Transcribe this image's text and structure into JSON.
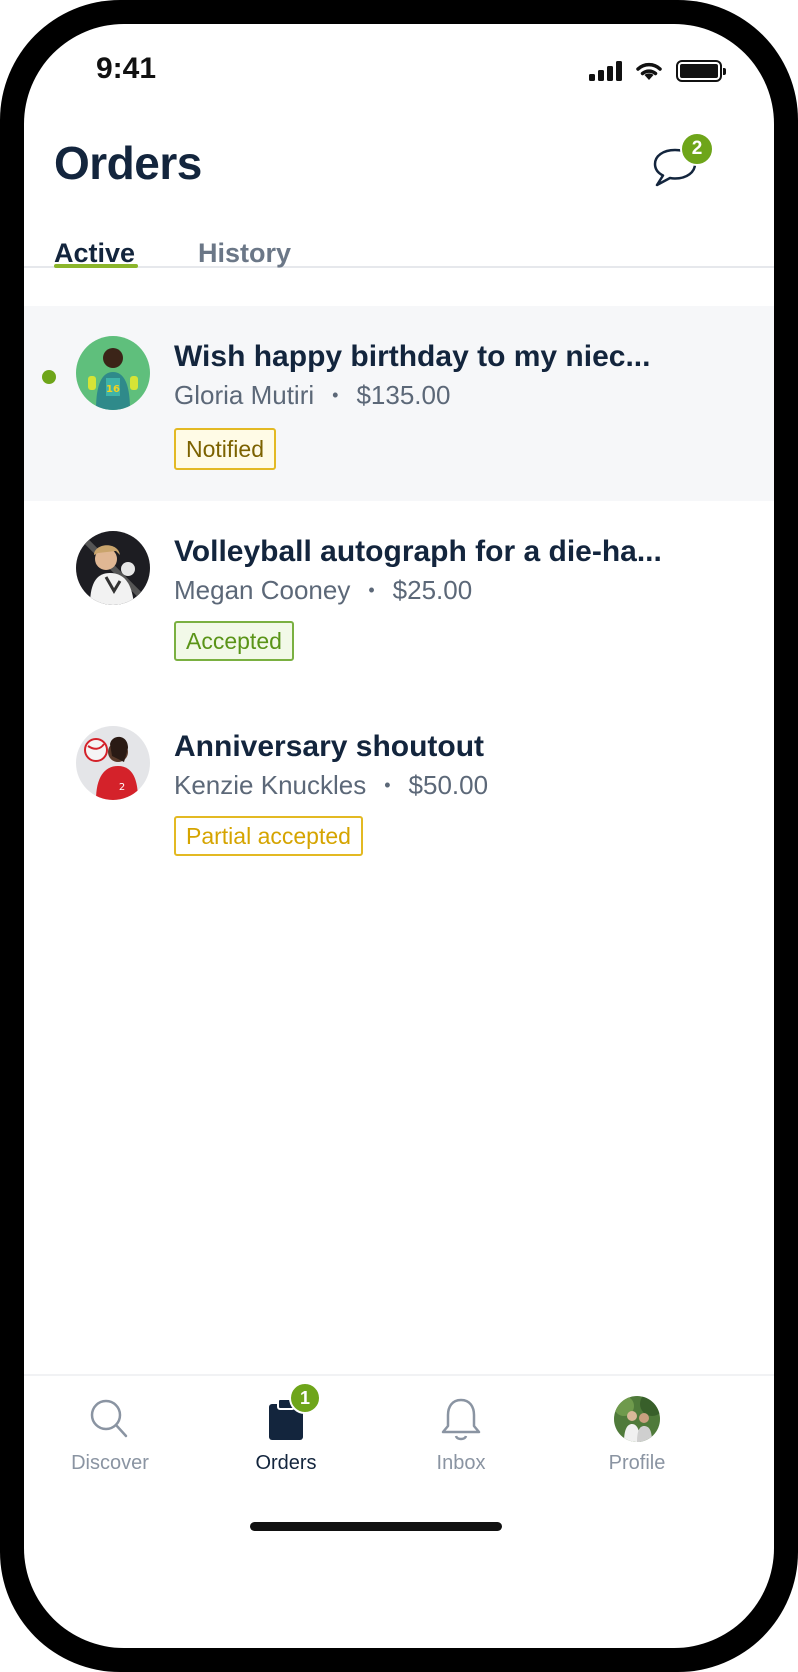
{
  "status_bar": {
    "time": "9:41"
  },
  "header": {
    "title": "Orders",
    "chat_badge_count": "2"
  },
  "tabs": [
    {
      "label": "Active",
      "active": true
    },
    {
      "label": "History",
      "active": false
    }
  ],
  "orders": [
    {
      "title": "Wish happy birthday to my niec...",
      "name": "Gloria Mutiri",
      "price": "$135.00",
      "status": "Notified",
      "unread": true
    },
    {
      "title": "Volleyball autograph for a die-ha...",
      "name": "Megan Cooney",
      "price": "$25.00",
      "status": "Accepted",
      "unread": false
    },
    {
      "title": "Anniversary shoutout",
      "name": "Kenzie Knuckles",
      "price": "$50.00",
      "status": "Partial accepted",
      "unread": false
    }
  ],
  "bottom_nav": {
    "items": [
      {
        "label": "Discover",
        "icon": "search-icon"
      },
      {
        "label": "Orders",
        "icon": "clipboard-icon",
        "badge": "1",
        "active": true
      },
      {
        "label": "Inbox",
        "icon": "bell-icon"
      },
      {
        "label": "Profile",
        "icon": "avatar"
      }
    ]
  },
  "colors": {
    "accent_green": "#6ea51a",
    "title_navy": "#13253d",
    "tag_yellow": "#e3b923",
    "tag_green": "#7ab041"
  },
  "separator": "•"
}
